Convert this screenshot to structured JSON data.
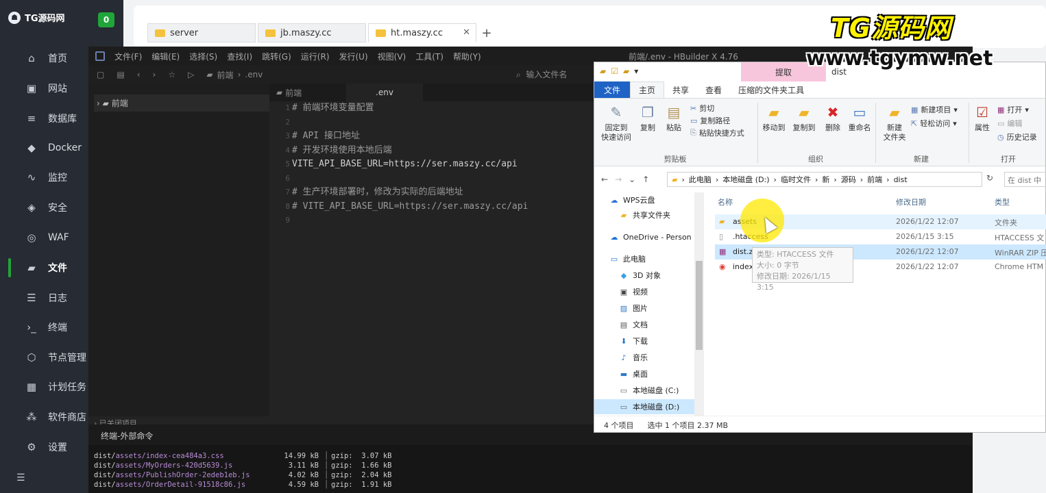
{
  "sidebar": {
    "brand": "TG源码网",
    "badge": "0",
    "items": [
      {
        "label": "首页",
        "icon": "home-icon"
      },
      {
        "label": "网站",
        "icon": "website-icon"
      },
      {
        "label": "数据库",
        "icon": "database-icon"
      },
      {
        "label": "Docker",
        "icon": "docker-icon"
      },
      {
        "label": "监控",
        "icon": "monitor-icon"
      },
      {
        "label": "安全",
        "icon": "shield-icon"
      },
      {
        "label": "WAF",
        "icon": "waf-icon"
      },
      {
        "label": "文件",
        "icon": "folder-icon"
      },
      {
        "label": "日志",
        "icon": "log-icon"
      },
      {
        "label": "终端",
        "icon": "terminal-icon"
      },
      {
        "label": "节点管理",
        "icon": "node-icon"
      },
      {
        "label": "计划任务",
        "icon": "calendar-icon"
      },
      {
        "label": "软件商店",
        "icon": "store-icon"
      },
      {
        "label": "设置",
        "icon": "settings-icon"
      }
    ]
  },
  "browser_tabs": [
    {
      "label": "server"
    },
    {
      "label": "jb.maszy.cc"
    },
    {
      "label": "ht.maszy.cc"
    }
  ],
  "editor": {
    "menu": [
      "文件(F)",
      "编辑(E)",
      "选择(S)",
      "查找(I)",
      "跳转(G)",
      "运行(R)",
      "发行(U)",
      "视图(V)",
      "工具(T)",
      "帮助(Y)"
    ],
    "title": "前端/.env - HBuilder X 4.76",
    "crumb_folder": "前端",
    "crumb_file": ".env",
    "search_placeholder": "输入文件名",
    "project_node": "前端",
    "closed_projects": "已关闭项目",
    "tabs": [
      "前端",
      ".env"
    ],
    "line_numbers": [
      "1",
      "2",
      "3",
      "4",
      "5",
      "6",
      "7",
      "8",
      "9"
    ],
    "code_lines": [
      "# 前端环境变量配置",
      "",
      "# API 接口地址",
      "# 开发环境使用本地后端",
      "VITE_API_BASE_URL=https://ser.maszy.cc/api",
      "",
      "# 生产环境部署时，修改为实际的后端地址",
      "# VITE_API_BASE_URL=https://ser.maszy.cc/api",
      ""
    ],
    "terminal_tab": "终端-外部命令",
    "terminal_rows": [
      {
        "dir": "dist/",
        "path": "assets/index-cea484a3.css",
        "size": "14.99 kB",
        "gzip": "gzip:  3.07 kB"
      },
      {
        "dir": "dist/",
        "path": "assets/MyOrders-420d5639.js",
        "size": "3.11 kB",
        "gzip": "gzip:  1.66 kB"
      },
      {
        "dir": "dist/",
        "path": "assets/PublishOrder-2edeb1eb.js",
        "size": "4.02 kB",
        "gzip": "gzip:  2.04 kB"
      },
      {
        "dir": "dist/",
        "path": "assets/OrderDetail-91518c86.js",
        "size": "4.59 kB",
        "gzip": "gzip:  1.91 kB"
      }
    ]
  },
  "file_explorer": {
    "context_tab": "提取",
    "folder_name": "dist",
    "ribbon_tabs": [
      "文件",
      "主页",
      "共享",
      "查看",
      "压缩的文件夹工具"
    ],
    "clipboard": {
      "pin": "固定到\n快速访问",
      "copy": "复制",
      "paste": "粘贴",
      "cut": "剪切",
      "copy_path": "复制路径",
      "paste_shortcut": "粘贴快捷方式",
      "group": "剪贴板"
    },
    "organize": {
      "move_to": "移动到",
      "copy_to": "复制到",
      "delete": "删除",
      "rename": "重命名",
      "group": "组织"
    },
    "new": {
      "new_folder": "新建\n文件夹",
      "new_item": "新建项目",
      "easy_access": "轻松访问",
      "group": "新建"
    },
    "open": {
      "properties": "属性",
      "open": "打开",
      "edit": "编辑",
      "history": "历史记录",
      "group": "打开"
    },
    "address": [
      "此电脑",
      "本地磁盘 (D:)",
      "临时文件",
      "新",
      "源码",
      "前端",
      "dist"
    ],
    "search_placeholder": "在 dist 中",
    "nav": [
      {
        "label": "WPS云盘",
        "icon": "cloud-icon"
      },
      {
        "label": "共享文件夹",
        "icon": "shared-folder-icon"
      },
      {
        "label": "OneDrive - Person",
        "icon": "onedrive-icon"
      },
      {
        "label": "此电脑",
        "icon": "computer-icon"
      },
      {
        "label": "3D 对象",
        "icon": "cube-icon"
      },
      {
        "label": "视频",
        "icon": "video-icon"
      },
      {
        "label": "图片",
        "icon": "picture-icon"
      },
      {
        "label": "文档",
        "icon": "document-icon"
      },
      {
        "label": "下载",
        "icon": "download-icon"
      },
      {
        "label": "音乐",
        "icon": "music-icon"
      },
      {
        "label": "桌面",
        "icon": "desktop-icon"
      },
      {
        "label": "本地磁盘 (C:)",
        "icon": "drive-icon"
      },
      {
        "label": "本地磁盘 (D:)",
        "icon": "drive-icon"
      }
    ],
    "columns": {
      "name": "名称",
      "date": "修改日期",
      "type": "类型"
    },
    "files": [
      {
        "name": "assets",
        "date": "2026/1/22 12:07",
        "type": "文件夹",
        "icon": "folder-icon"
      },
      {
        "name": ".htaccess",
        "date": "2026/1/15 3:15",
        "type": "HTACCESS 文",
        "icon": "file-icon"
      },
      {
        "name": "dist.zip",
        "date": "2026/1/22 12:07",
        "type": "WinRAR ZIP 压",
        "icon": "winrar-icon"
      },
      {
        "name": "index.html",
        "date": "2026/1/22 12:07",
        "type": "Chrome HTM",
        "icon": "chrome-icon"
      }
    ],
    "tooltip": {
      "type": "类型: HTACCESS 文件",
      "size": "大小: 0 字节",
      "modified": "修改日期: 2026/1/15 3:15"
    },
    "status": {
      "count": "4 个项目",
      "selected": "选中 1 个项目  2.37 MB"
    }
  },
  "watermark": {
    "title": "TG源码网",
    "url": "www.tgymw.net"
  }
}
